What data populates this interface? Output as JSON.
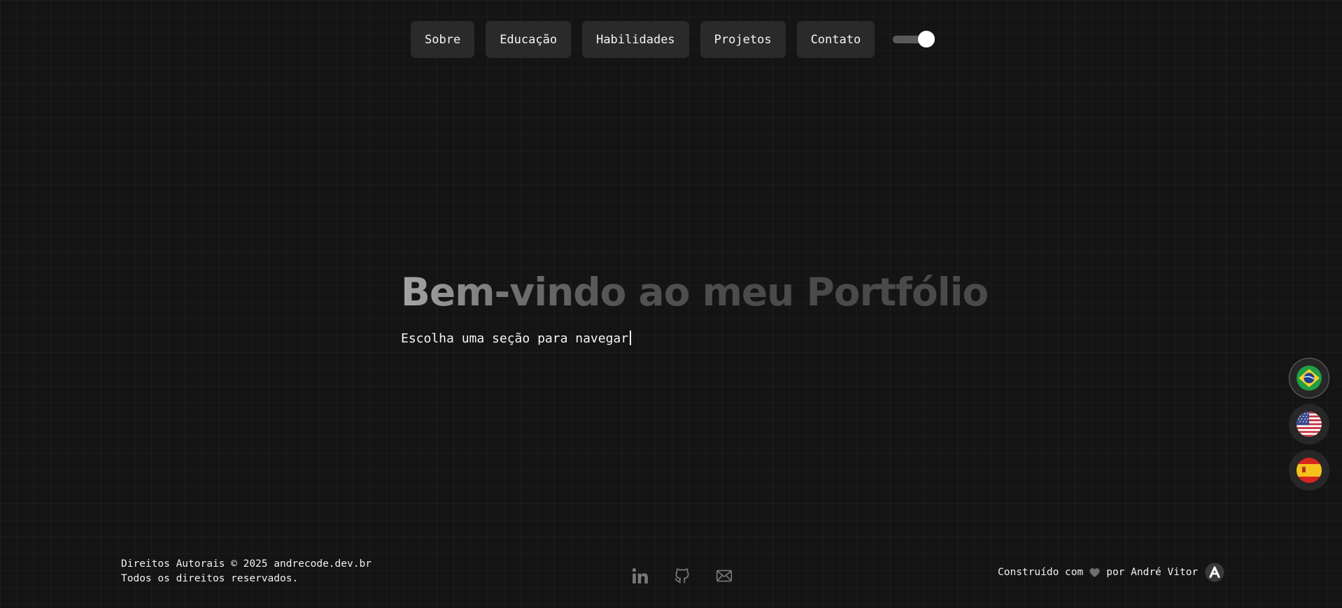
{
  "nav": {
    "items": [
      {
        "label": "Sobre"
      },
      {
        "label": "Educação"
      },
      {
        "label": "Habilidades"
      },
      {
        "label": "Projetos"
      },
      {
        "label": "Contato"
      }
    ],
    "theme_toggle": {
      "state": "on"
    }
  },
  "hero": {
    "title": "Bem-vindo ao meu Portfólio",
    "subtitle": "Escolha uma seção para navegar"
  },
  "languages": [
    {
      "icon": "brazil-flag-icon",
      "active": true
    },
    {
      "icon": "usa-flag-icon",
      "active": false
    },
    {
      "icon": "spain-flag-icon",
      "active": false
    }
  ],
  "footer": {
    "copyright": "Direitos Autorais © 2025 andrecode.dev.br",
    "rights": "Todos os direitos reservados.",
    "socials": [
      {
        "icon": "linkedin-icon"
      },
      {
        "icon": "github-icon"
      },
      {
        "icon": "mail-icon"
      }
    ],
    "built_with": "Construído com",
    "built_by": "por André Vitor",
    "heart_icon": "heart-icon",
    "logo_icon": "logo-a-icon"
  },
  "colors": {
    "background": "#141414",
    "button_bg": "#2a2a2a",
    "text": "#f2f2f2",
    "muted_icon": "#7a7a7a"
  }
}
